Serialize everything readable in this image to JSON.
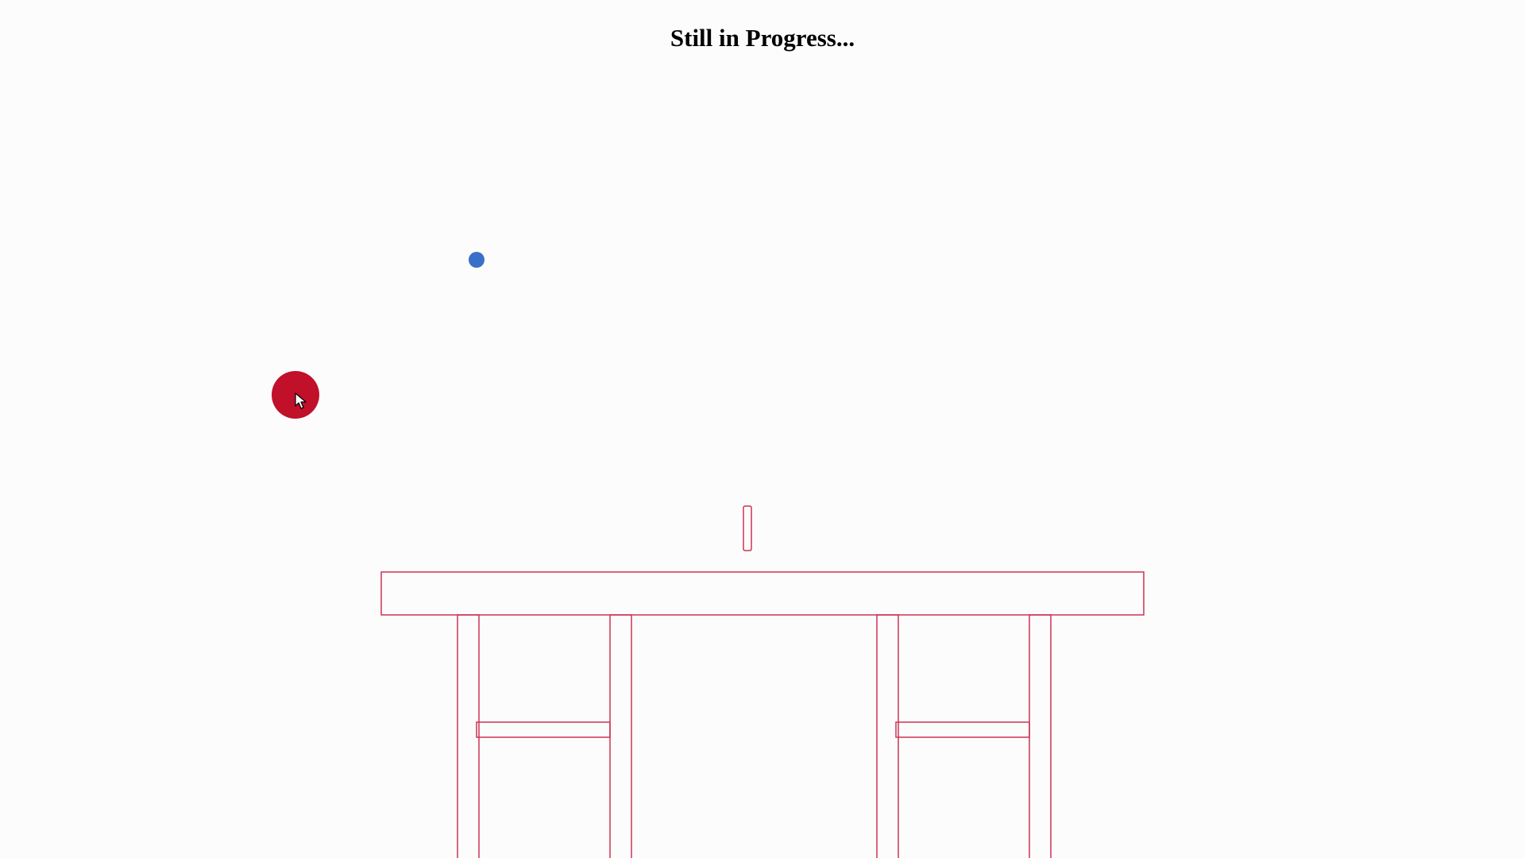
{
  "header": {
    "title": "Still in Progress..."
  },
  "colors": {
    "background": "#fcfcfc",
    "table_outline": "#cc3355",
    "paddle_outline": "#cc3355",
    "ball": "#3a6fc9",
    "player_disc": "#c0102a"
  },
  "icons": {
    "cursor": "arrow-cursor-icon"
  }
}
